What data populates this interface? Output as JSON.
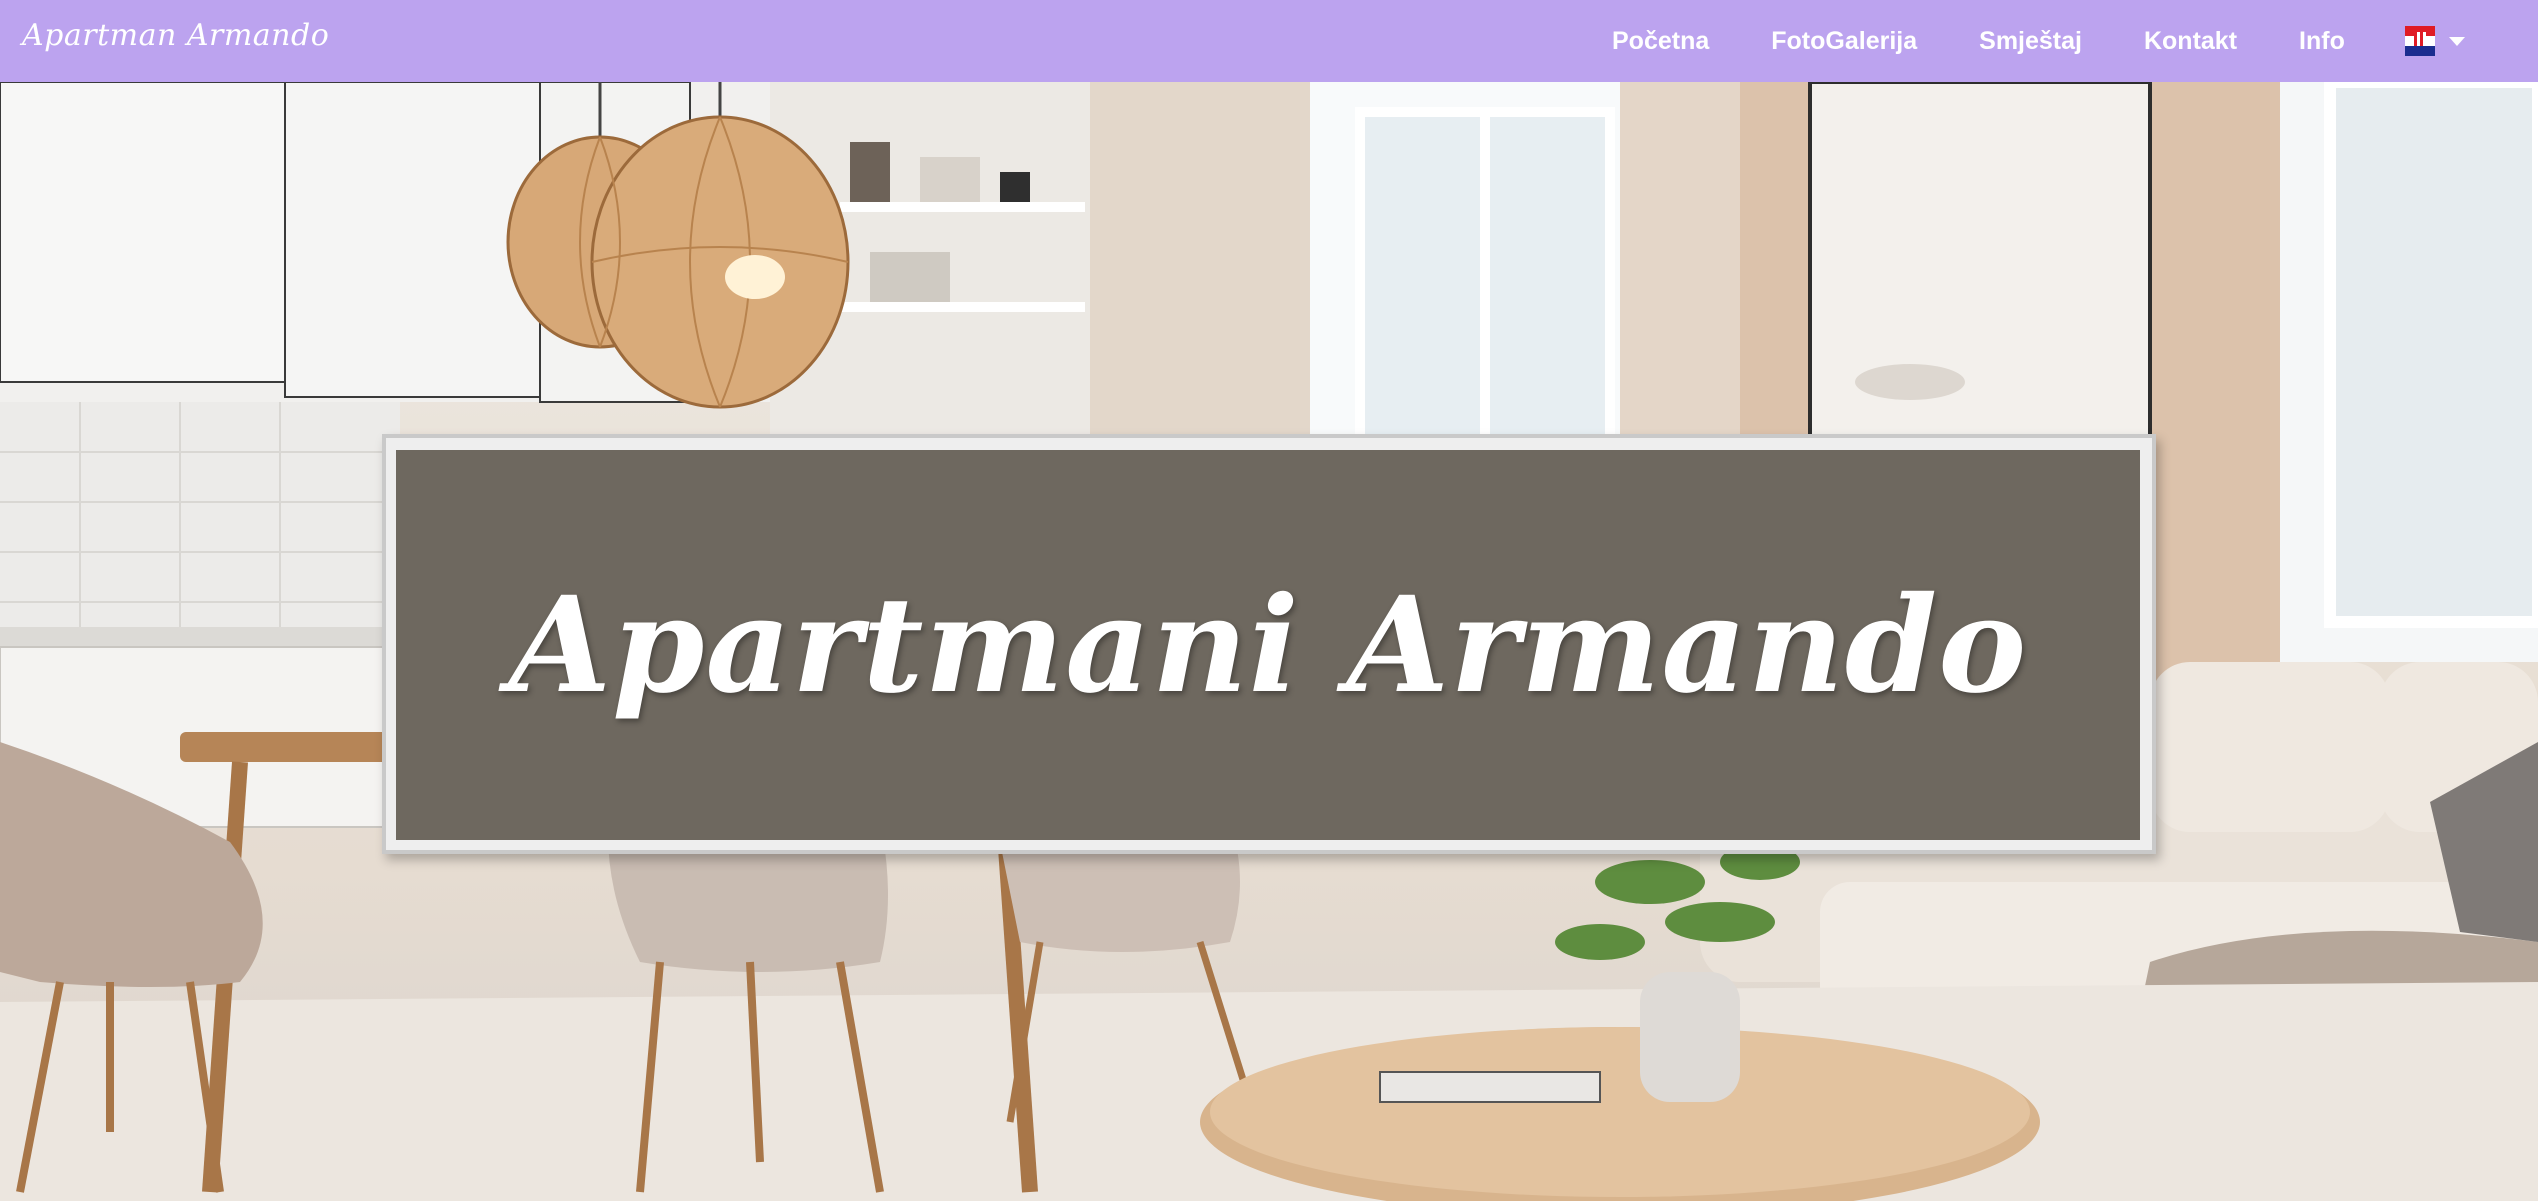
{
  "brand": "Apartman Armando",
  "nav": {
    "items": [
      "Početna",
      "FotoGalerija",
      "Smještaj",
      "Kontakt",
      "Info"
    ],
    "language": {
      "flag_icon": "croatia-flag-icon",
      "dropdown_icon": "caret-down-icon"
    }
  },
  "hero": {
    "title": "Apartmani Armando",
    "background": "living-room-photo"
  },
  "colors": {
    "navbar": "#bca3ef",
    "panel_overlay": "#5c554b",
    "text": "#ffffff"
  }
}
